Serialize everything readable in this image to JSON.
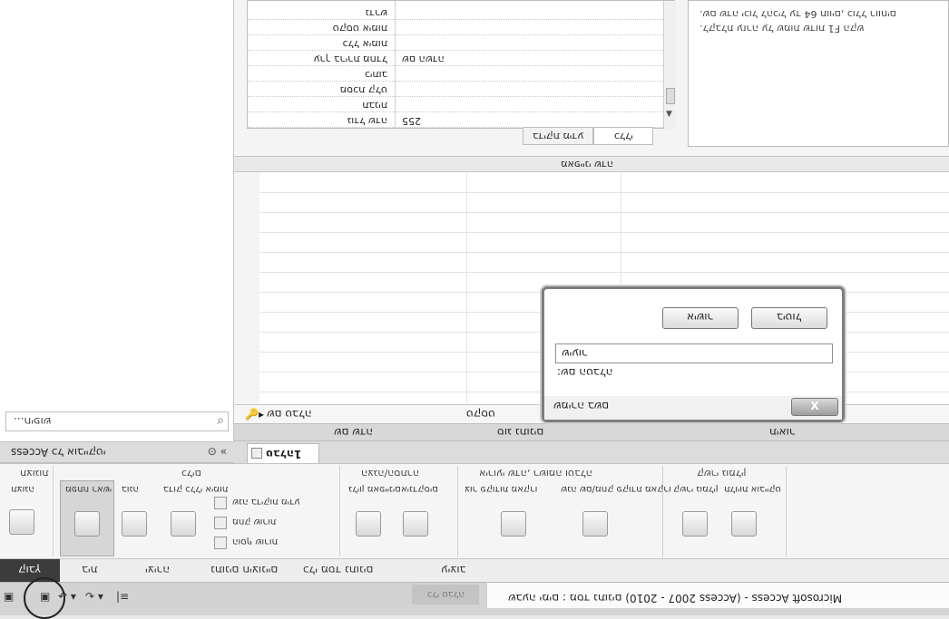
{
  "window": {
    "title": "Microsoft Access - (Access 2007 - 2010) שבעה ימים : מסד נתונים"
  },
  "quick_access": {
    "save_icon": "save-icon",
    "undo_icon": "undo-icon",
    "redo_icon": "redo-icon"
  },
  "ribbon_tabs": [
    "קובץ",
    "בית",
    "יצירה",
    "נתונים חיצוניים",
    "כלי מסד נתונים",
    "עיצוב"
  ],
  "ribbon_tools_ghost": "כלי טבלה",
  "ribbon": {
    "groups": [
      {
        "label": "תצוגות",
        "items": [
          "תצוגה"
        ]
      },
      {
        "label": "כלים",
        "items": [
          "מפתח ראשי",
          "בונה",
          "בדוק כללי אימות",
          "הוסף שורות",
          "מחק שורות",
          "שנה בדיקות מידע"
        ]
      },
      {
        "label": "הצגה/הסתרה",
        "items": [
          "גליון מאפיינים",
          "אינדקסים"
        ]
      },
      {
        "label": "אירועי שדה, רשומה וטבלה",
        "items": [
          "צור פקודות מאקרו",
          "שנה שם/מחק פקודת מאקרו"
        ]
      },
      {
        "label": "קשרי גומלין",
        "items": [
          "קשרי גומלין",
          "תלויות אובייקט"
        ]
      }
    ]
  },
  "nav_pane": {
    "header": "כל אובייקטי Access",
    "search_placeholder": "חיפוש..."
  },
  "document_tab": "טבלה1",
  "columns": [
    "שם שדה",
    "סוג נתונים",
    "תיאור"
  ],
  "design_grid": {
    "first_row_field": "שם טבלה",
    "first_row_type": "טקסט"
  },
  "field_properties": {
    "title": "מאפייני שדה",
    "tabs": [
      "כללי",
      "בדיקת מידע"
    ],
    "rows": [
      {
        "key": "גודל שדה",
        "value": "255"
      },
      {
        "key": "תבנית",
        "value": ""
      },
      {
        "key": "מסכת קלט",
        "value": ""
      },
      {
        "key": "כיתוב",
        "value": ""
      },
      {
        "key": "ערך ברירת מחדל",
        "value": "שם השדה"
      },
      {
        "key": "כלל אימות",
        "value": ""
      },
      {
        "key": "טקסט אימות",
        "value": ""
      },
      {
        "key": "נדרש",
        "value": ""
      }
    ],
    "help_lines": [
      "שם שדה יכול להכיל עד 64 תווים, כולל רווחים.",
      "הקש F1 לקבלת עזרה על שמות שדות."
    ]
  },
  "dialog": {
    "title": "שמירה בשם",
    "label": "שם הטבלה:",
    "value": "שיעור",
    "ok_label": "אישור",
    "cancel_label": "ביטול",
    "close_label": "X"
  }
}
